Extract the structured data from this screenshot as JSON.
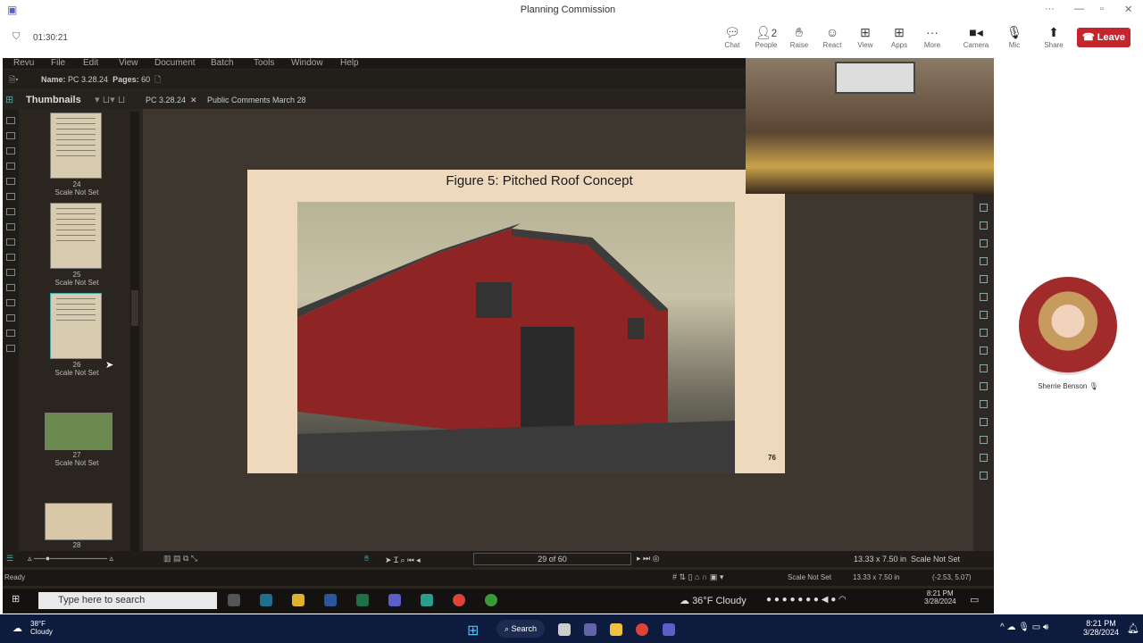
{
  "window": {
    "title": "Planning Commission"
  },
  "meeting": {
    "timer": "01:30:21",
    "controls": [
      {
        "icon": "chat-icon",
        "label": "Chat"
      },
      {
        "icon": "people-icon",
        "label": "People",
        "badge": "2"
      },
      {
        "icon": "hand-icon",
        "label": "Raise"
      },
      {
        "icon": "smile-icon",
        "label": "React"
      },
      {
        "icon": "grid-icon",
        "label": "View"
      },
      {
        "icon": "plus-box-icon",
        "label": "Apps"
      },
      {
        "icon": "more-icon",
        "label": "More"
      },
      {
        "icon": "camera-icon",
        "label": "Camera"
      },
      {
        "icon": "mic-icon",
        "label": "Mic"
      },
      {
        "icon": "share-icon",
        "label": "Share"
      }
    ],
    "leave": "Leave",
    "participant": "Sherrie Benson",
    "leave_color": "#c4262e"
  },
  "revu": {
    "menu": [
      "Revu",
      "File",
      "Edit",
      "View",
      "Document",
      "Batch",
      "Tools",
      "Window",
      "Help"
    ],
    "name_label": "Name:",
    "name_value": "PC 3.28.24",
    "pages_label": "Pages:",
    "pages_value": "60",
    "panel_title": "Thumbnails",
    "tabs": [
      "PC 3.28.24",
      "Public Comments March 28"
    ],
    "thumbnails": [
      {
        "page": "24",
        "scale": "Scale Not Set"
      },
      {
        "page": "25",
        "scale": "Scale Not Set"
      },
      {
        "page": "26",
        "scale": "Scale Not Set"
      },
      {
        "page": "27",
        "scale": "Scale Not Set"
      },
      {
        "page": "28",
        "scale": ""
      }
    ],
    "slide_title": "Figure 5:  Pitched Roof Concept",
    "slide_page": "76",
    "page_indicator": "29 of 60",
    "page_size": "13.33 x 7.50 in",
    "scale": "Scale Not Set",
    "status": "Ready",
    "status_scale": "Scale Not Set",
    "status_size": "13.33 x 7.50 in",
    "coords": "(-2.53, 5.07)"
  },
  "remote_taskbar": {
    "search_placeholder": "Type here to search",
    "weather": "36°F  Cloudy",
    "time": "8:21 PM",
    "date": "3/28/2024"
  },
  "taskbar": {
    "temp": "38°F",
    "condition": "Cloudy",
    "search": "Search",
    "time": "8:21 PM",
    "date": "3/28/2024"
  }
}
